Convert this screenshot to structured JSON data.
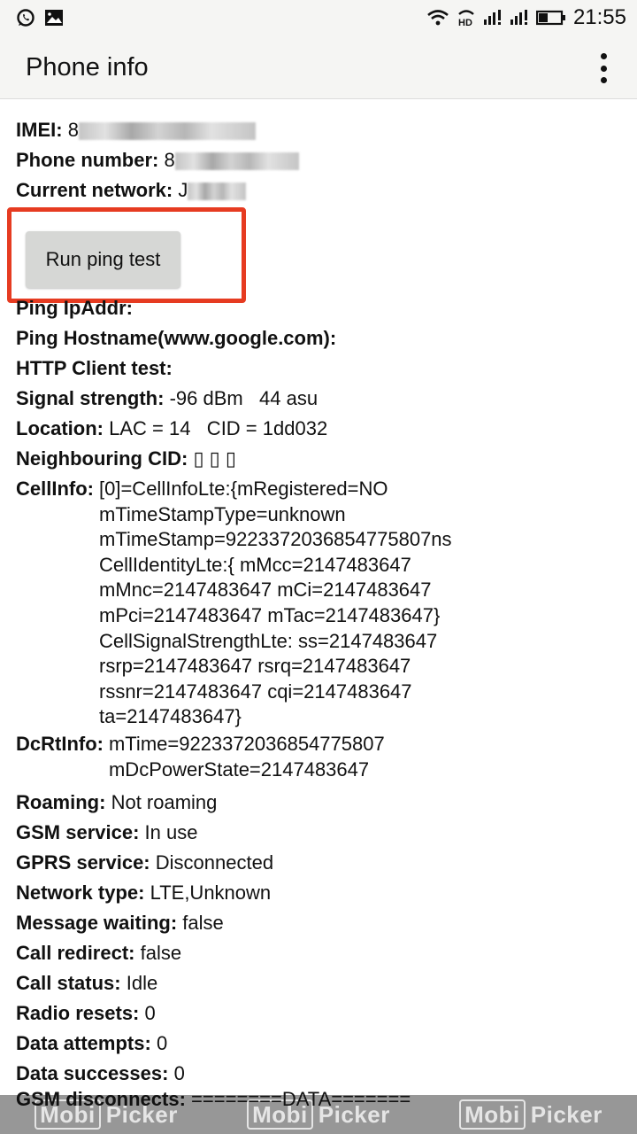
{
  "status_bar": {
    "left_icons": [
      "whatsapp-icon",
      "gallery-icon"
    ],
    "right_icons": [
      "wifi-icon",
      "hd-volte-icon",
      "signal-sim1-icon",
      "signal-sim2-icon",
      "battery-icon"
    ],
    "hd_label": "HD",
    "time": "21:55"
  },
  "app_bar": {
    "title": "Phone info",
    "menu_icon": "overflow-menu-icon"
  },
  "identity": [
    {
      "label": "IMEI:",
      "value": "8"
    },
    {
      "label": "Phone number:",
      "value": "8"
    },
    {
      "label": "Current network:",
      "value": "J"
    }
  ],
  "ping_button": {
    "label": "Run ping test",
    "highlight_color": "#e63b21"
  },
  "results": [
    {
      "label": "Ping IpAddr:",
      "value": ""
    },
    {
      "label": "Ping Hostname(www.google.com):",
      "value": ""
    },
    {
      "label": "HTTP Client test:",
      "value": ""
    },
    {
      "label": "Signal strength:",
      "value": "-96 dBm   44 asu"
    },
    {
      "label": "Location:",
      "value": "LAC = 14   CID = 1dd032"
    },
    {
      "label": "Neighbouring CID:",
      "value": "▯ ▯ ▯"
    }
  ],
  "cell_info": {
    "label": "CellInfo:",
    "lines": [
      "[0]=CellInfoLte:{mRegistered=NO",
      "mTimeStampType=unknown",
      "mTimeStamp=9223372036854775807ns",
      "CellIdentityLte:{ mMcc=2147483647",
      "mMnc=2147483647 mCi=2147483647",
      "mPci=2147483647 mTac=2147483647}",
      "CellSignalStrengthLte: ss=2147483647",
      "rsrp=2147483647 rsrq=2147483647",
      "rssnr=2147483647 cqi=2147483647",
      "ta=2147483647}"
    ]
  },
  "dcrt_info": {
    "label": "DcRtInfo:",
    "lines": [
      "mTime=9223372036854775807",
      "mDcPowerState=2147483647"
    ]
  },
  "status_rows": [
    {
      "label": "Roaming:",
      "value": "Not roaming"
    },
    {
      "label": "GSM service:",
      "value": "In use"
    },
    {
      "label": "GPRS service:",
      "value": "Disconnected"
    },
    {
      "label": "Network type:",
      "value": "LTE,Unknown"
    },
    {
      "label": "Message waiting:",
      "value": "false"
    },
    {
      "label": "Call redirect:",
      "value": "false"
    },
    {
      "label": "Call status:",
      "value": "Idle"
    },
    {
      "label": "Radio resets:",
      "value": "0"
    },
    {
      "label": "Data attempts:",
      "value": "0"
    },
    {
      "label": "Data successes:",
      "value": "0"
    }
  ],
  "gsm_disconnects": {
    "label": "GSM disconnects:",
    "value": "========DATA======="
  },
  "watermark": {
    "brand_box": "Mobi",
    "brand_text": "Picker",
    "count": 3
  }
}
